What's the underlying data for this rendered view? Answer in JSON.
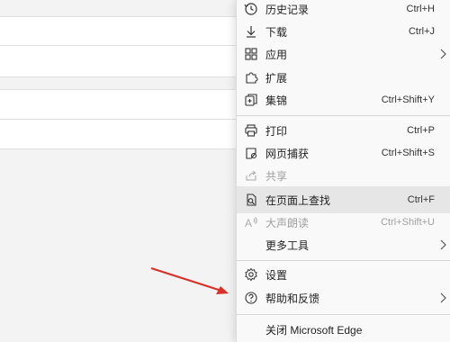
{
  "menu": {
    "items": [
      {
        "label": "历史记录",
        "shortcut": "Ctrl+H",
        "icon": "history-icon"
      },
      {
        "label": "下载",
        "shortcut": "Ctrl+J",
        "icon": "download-icon"
      },
      {
        "label": "应用",
        "shortcut": "",
        "icon": "apps-icon",
        "submenu": true
      },
      {
        "label": "扩展",
        "shortcut": "",
        "icon": "extensions-icon"
      },
      {
        "label": "集锦",
        "shortcut": "Ctrl+Shift+Y",
        "icon": "collections-icon"
      },
      {
        "label": "打印",
        "shortcut": "Ctrl+P",
        "icon": "print-icon"
      },
      {
        "label": "网页捕获",
        "shortcut": "Ctrl+Shift+S",
        "icon": "web-capture-icon"
      },
      {
        "label": "共享",
        "shortcut": "",
        "icon": "share-icon",
        "disabled": true
      },
      {
        "label": "在页面上查找",
        "shortcut": "Ctrl+F",
        "icon": "find-icon",
        "highlighted": true
      },
      {
        "label": "大声朗读",
        "shortcut": "Ctrl+Shift+U",
        "icon": "read-aloud-icon",
        "disabled": true
      },
      {
        "label": "更多工具",
        "shortcut": "",
        "icon": "",
        "submenu": true
      },
      {
        "label": "设置",
        "shortcut": "",
        "icon": "settings-icon"
      },
      {
        "label": "帮助和反馈",
        "shortcut": "",
        "icon": "help-icon",
        "submenu": true
      },
      {
        "label": "关闭 Microsoft Edge",
        "shortcut": "",
        "icon": ""
      }
    ]
  },
  "colors": {
    "menu_bg": "#f9f9f9",
    "highlight": "#e6e6e6",
    "annotation_arrow": "#d9302a",
    "disabled_text": "#a0a0a0"
  }
}
